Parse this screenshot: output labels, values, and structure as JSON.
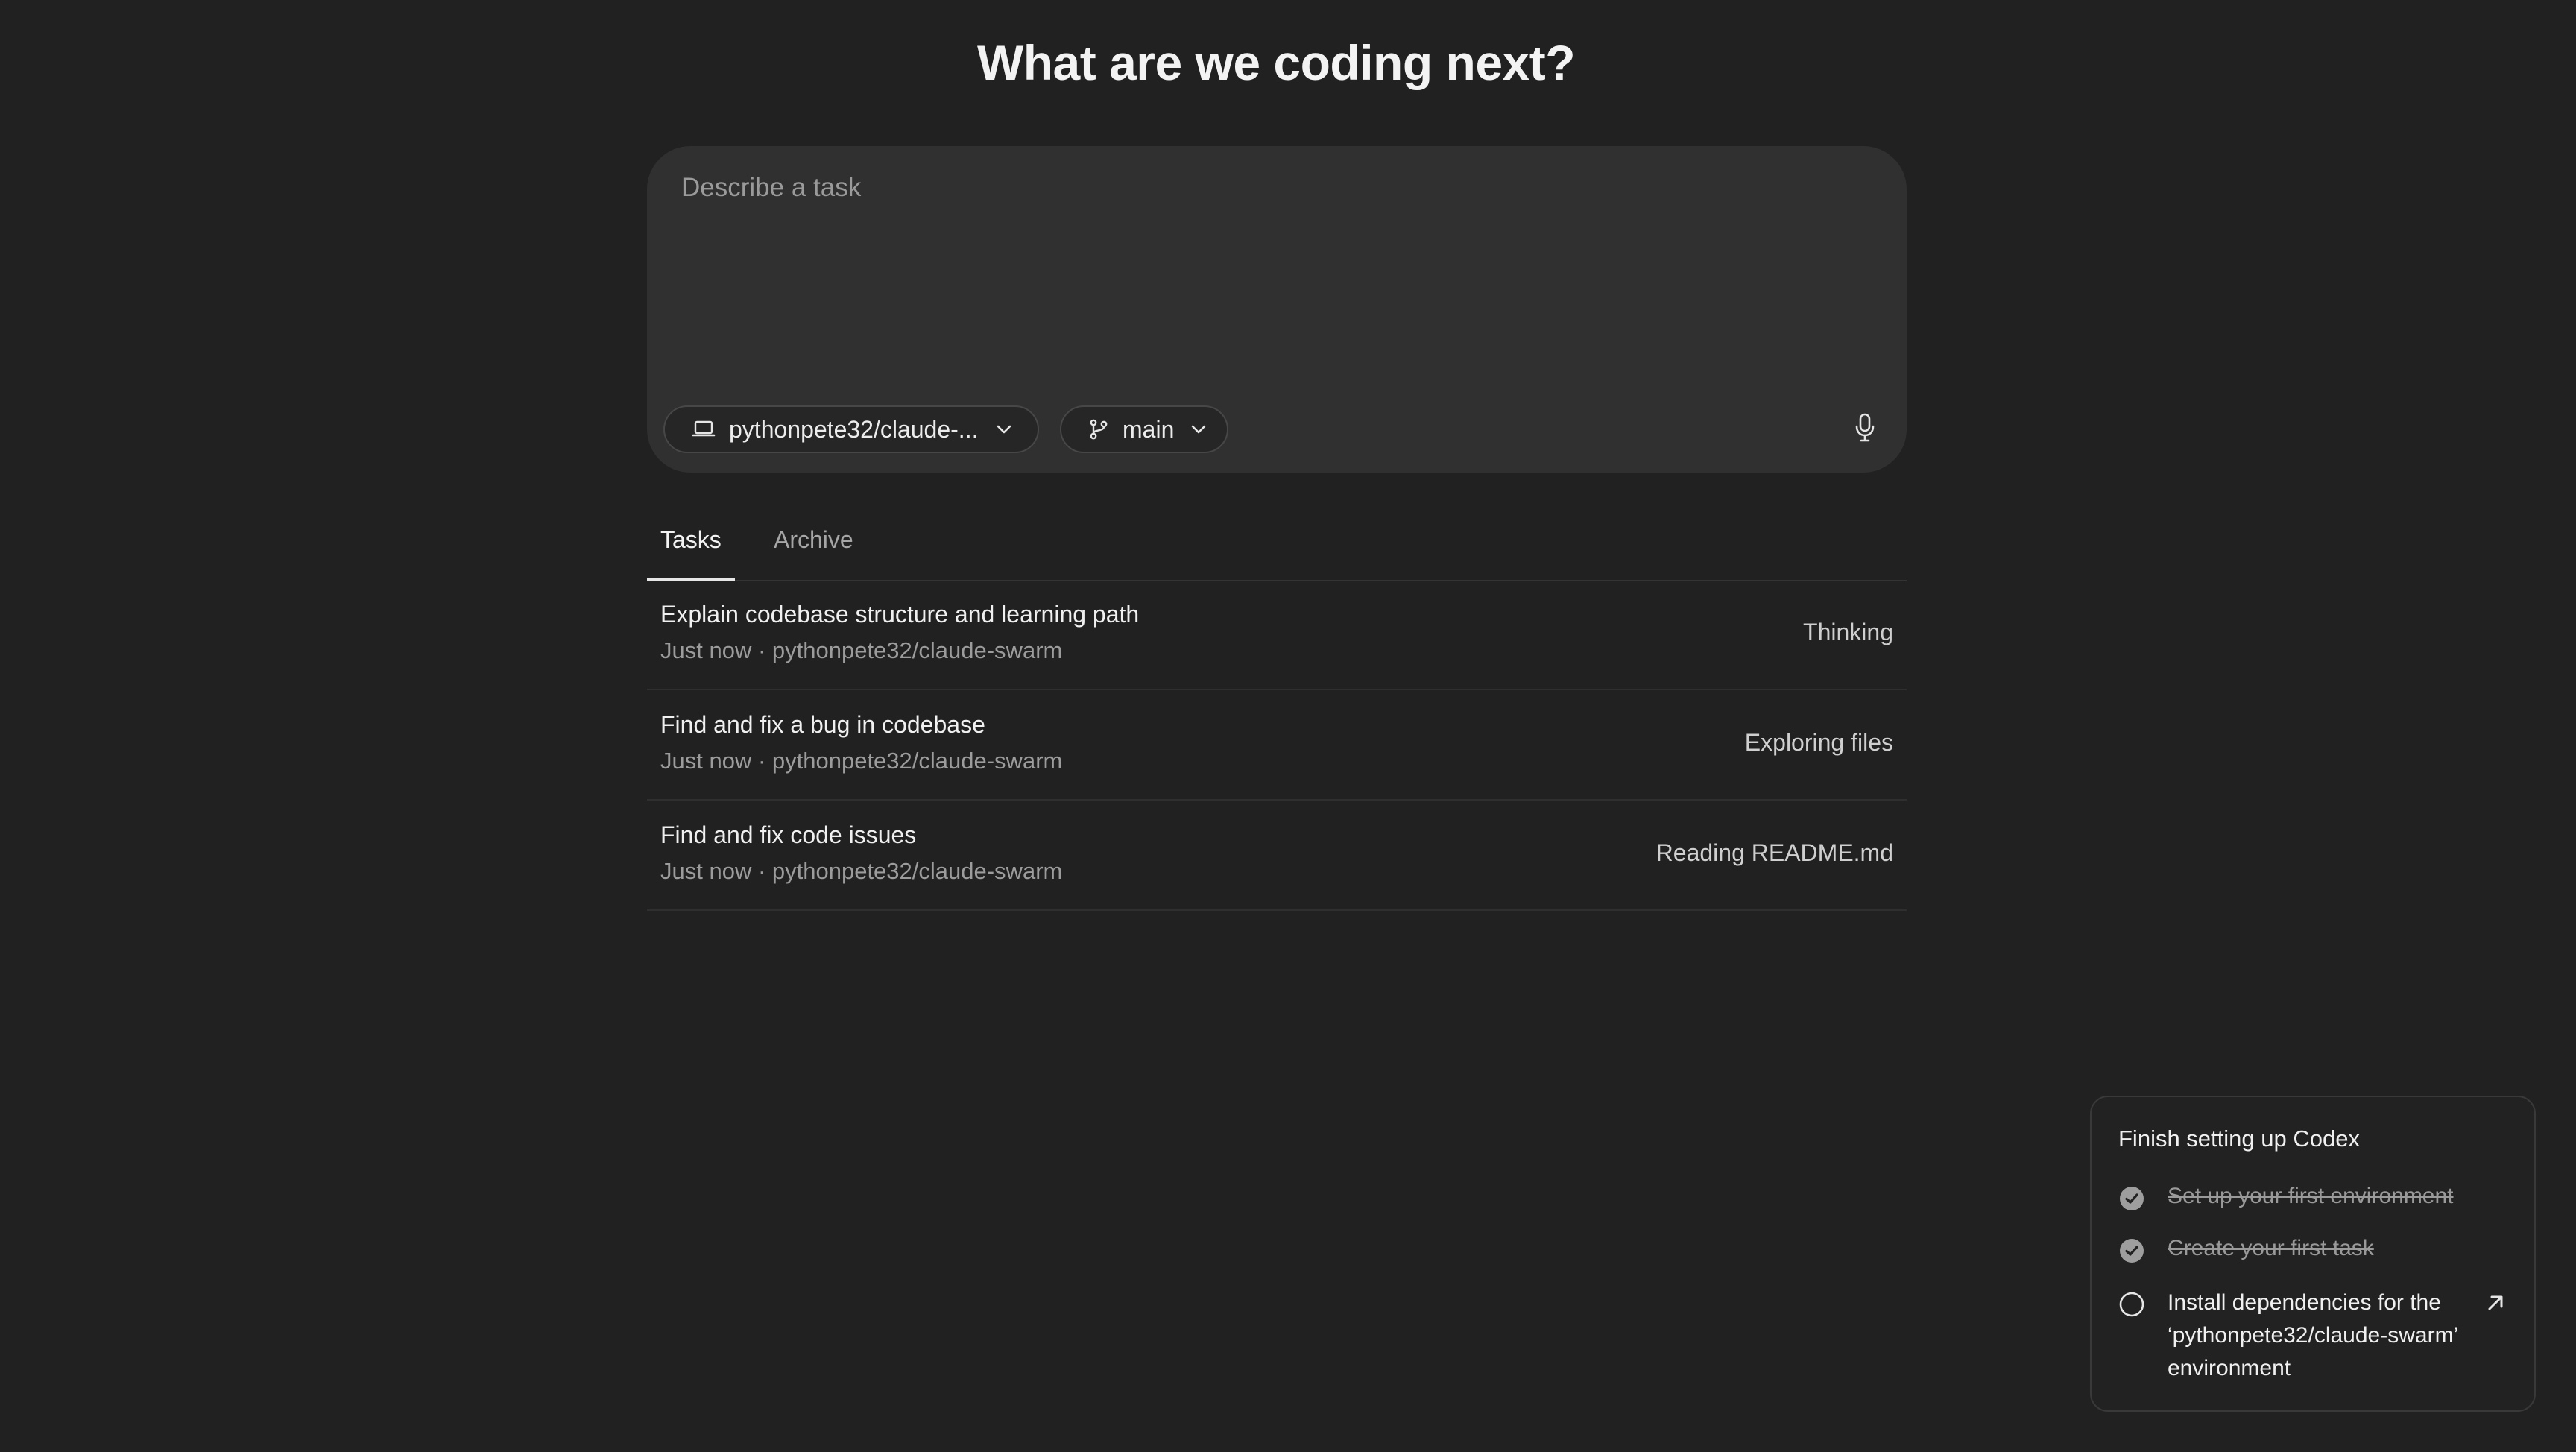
{
  "header": {
    "title": "What are we coding next?"
  },
  "composer": {
    "placeholder": "Describe a task",
    "environment_label": "pythonpete32/claude-...",
    "branch_label": "main"
  },
  "tabs": [
    {
      "label": "Tasks",
      "active": true
    },
    {
      "label": "Archive",
      "active": false
    }
  ],
  "tasks": [
    {
      "title": "Explain codebase structure and learning path",
      "meta": "Just now · pythonpete32/claude-swarm",
      "status": "Thinking"
    },
    {
      "title": "Find and fix a bug in codebase",
      "meta": "Just now · pythonpete32/claude-swarm",
      "status": "Exploring files"
    },
    {
      "title": "Find and fix code issues",
      "meta": "Just now · pythonpete32/claude-swarm",
      "status": "Reading README.md"
    }
  ],
  "setup": {
    "title": "Finish setting up Codex",
    "steps": [
      {
        "label": "Set up your first environment",
        "done": true
      },
      {
        "label": "Create your first task",
        "done": true
      },
      {
        "label": "Install dependencies for the ‘pythonpete32/claude-swarm’ environment",
        "done": false
      }
    ]
  },
  "icons": {
    "environment": "laptop-icon",
    "branch": "git-branch-icon",
    "dropdown": "chevron-down-icon",
    "mic": "microphone-icon",
    "done": "check-circle-icon",
    "todo": "empty-circle-icon",
    "open": "arrow-up-right-icon"
  },
  "colors": {
    "background": "#212121",
    "composer": "#303030",
    "text": "#ececec",
    "muted": "#9c9c9c"
  }
}
